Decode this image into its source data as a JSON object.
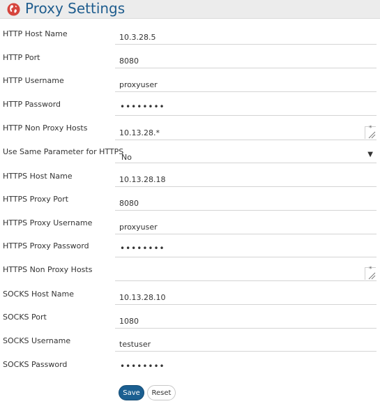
{
  "header": {
    "title": "Proxy Settings",
    "icon": "globe-icon"
  },
  "form": {
    "rows": [
      {
        "label": "HTTP Host Name",
        "value": "10.3.28.5",
        "kind": "text"
      },
      {
        "label": "HTTP Port",
        "value": "8080",
        "kind": "text"
      },
      {
        "label": "HTTP Username",
        "value": "proxyuser",
        "kind": "text"
      },
      {
        "label": "HTTP Password",
        "value": "••••••••",
        "kind": "password"
      },
      {
        "label": "HTTP Non Proxy Hosts",
        "value": "10.13.28.*",
        "kind": "textarea"
      },
      {
        "label": "Use Same Parameter for HTTPS",
        "value": "No",
        "kind": "select"
      },
      {
        "label": "HTTPS Host Name",
        "value": "10.13.28.18",
        "kind": "text"
      },
      {
        "label": "HTTPS Proxy Port",
        "value": "8080",
        "kind": "text"
      },
      {
        "label": "HTTPS Proxy Username",
        "value": "proxyuser",
        "kind": "text"
      },
      {
        "label": "HTTPS Proxy Password",
        "value": "••••••••",
        "kind": "password"
      },
      {
        "label": "HTTPS Non Proxy Hosts",
        "value": "",
        "kind": "textarea"
      },
      {
        "label": "SOCKS Host Name",
        "value": "10.13.28.10",
        "kind": "text"
      },
      {
        "label": "SOCKS Port",
        "value": "1080",
        "kind": "text"
      },
      {
        "label": "SOCKS Username",
        "value": "testuser",
        "kind": "text"
      },
      {
        "label": "SOCKS Password",
        "value": "••••••••",
        "kind": "password"
      }
    ]
  },
  "buttons": {
    "save_label": "Save",
    "reset_label": "Reset"
  },
  "colors": {
    "title": "#1f5d8e",
    "save_button": "#1b5f91",
    "globe": "#d6453d"
  }
}
